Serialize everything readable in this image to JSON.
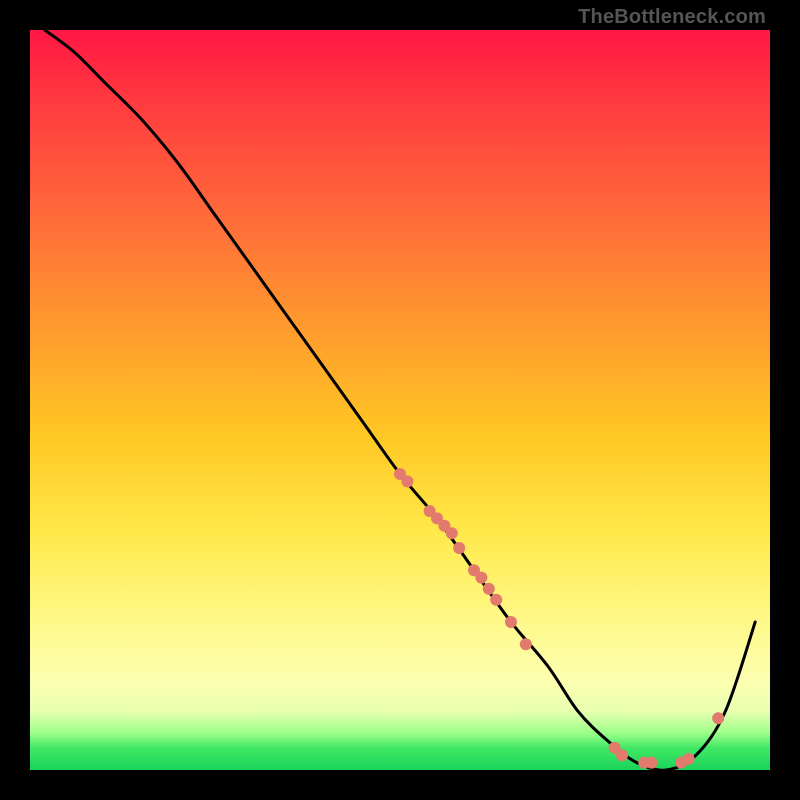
{
  "watermark": "TheBottleneck.com",
  "chart_data": {
    "type": "line",
    "title": "",
    "xlabel": "",
    "ylabel": "",
    "xlim": [
      0,
      100
    ],
    "ylim": [
      0,
      100
    ],
    "grid": false,
    "legend": false,
    "series": [
      {
        "name": "bottleneck-curve",
        "x": [
          2,
          6,
          10,
          15,
          20,
          25,
          30,
          35,
          40,
          45,
          50,
          55,
          60,
          65,
          70,
          74,
          78,
          82,
          86,
          90,
          94,
          98
        ],
        "y": [
          100,
          97,
          93,
          88,
          82,
          75,
          68,
          61,
          54,
          47,
          40,
          34,
          27,
          20,
          14,
          8,
          4,
          1,
          0,
          2,
          8,
          20
        ],
        "stroke": "#000000",
        "stroke_width": 2
      }
    ],
    "markers": [
      {
        "x": 50,
        "y": 40
      },
      {
        "x": 51,
        "y": 39
      },
      {
        "x": 54,
        "y": 35
      },
      {
        "x": 55,
        "y": 34
      },
      {
        "x": 56,
        "y": 33
      },
      {
        "x": 57,
        "y": 32
      },
      {
        "x": 58,
        "y": 30
      },
      {
        "x": 60,
        "y": 27
      },
      {
        "x": 61,
        "y": 26
      },
      {
        "x": 62,
        "y": 24.5
      },
      {
        "x": 63,
        "y": 23
      },
      {
        "x": 65,
        "y": 20
      },
      {
        "x": 67,
        "y": 17
      },
      {
        "x": 79,
        "y": 3
      },
      {
        "x": 80,
        "y": 2
      },
      {
        "x": 83,
        "y": 1
      },
      {
        "x": 84,
        "y": 1
      },
      {
        "x": 88,
        "y": 1
      },
      {
        "x": 89,
        "y": 1.5
      },
      {
        "x": 93,
        "y": 7
      }
    ],
    "marker_style": {
      "fill": "#e37a6e",
      "r": 6
    }
  }
}
